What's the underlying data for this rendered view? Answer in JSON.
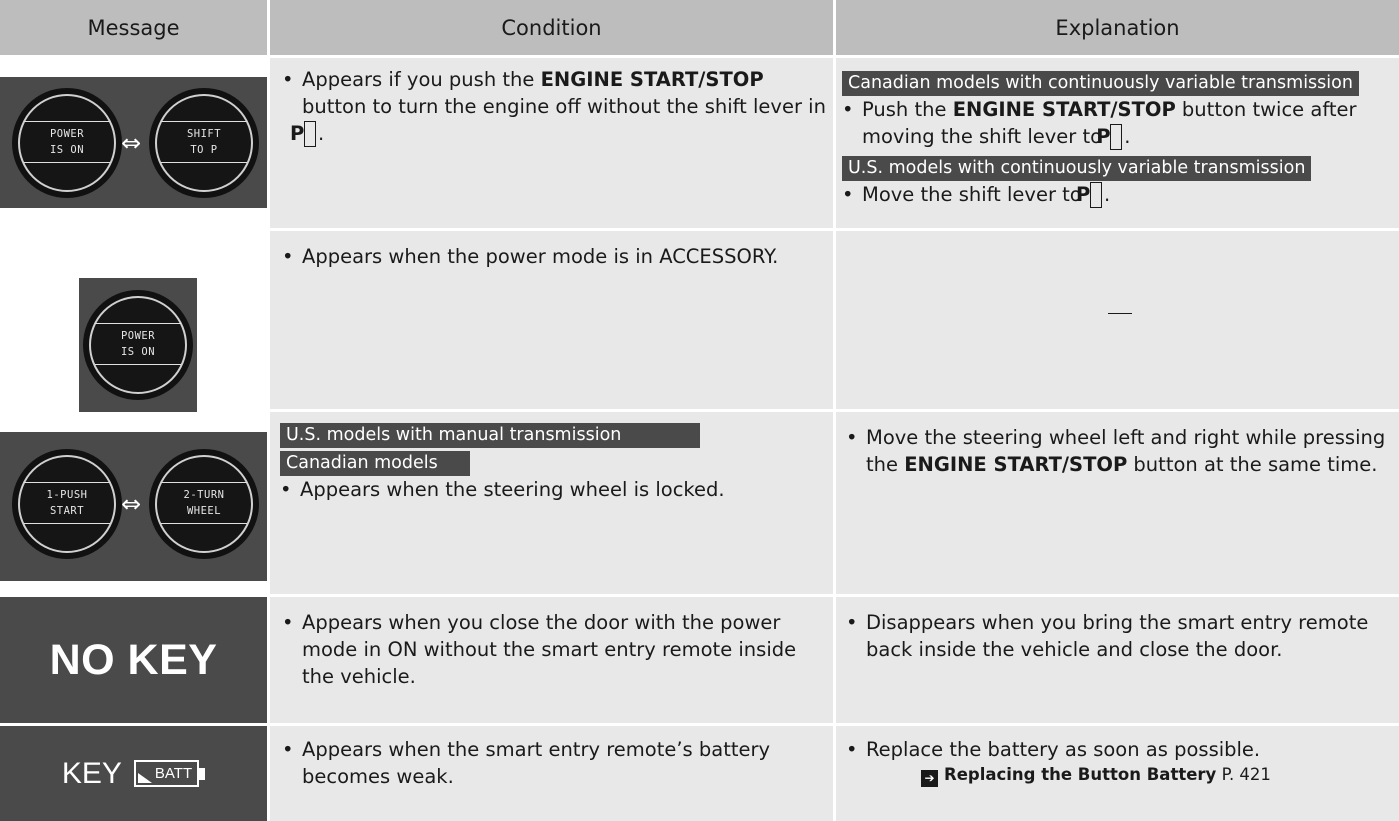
{
  "header": {
    "message": "Message",
    "condition": "Condition",
    "explanation": "Explanation"
  },
  "rows": [
    {
      "message_display": {
        "gauge1": [
          "POWER",
          "IS ON"
        ],
        "gauge2": [
          "SHIFT",
          "TO P"
        ],
        "arrow": "⇔"
      },
      "condition": {
        "pre": "Appears if you push the ",
        "bold": "ENGINE START/STOP",
        "post": " button to turn the engine off without the shift lever in ",
        "gear": "P",
        "end": "."
      },
      "explanation": {
        "tag1": "Canadian models with continuously variable transmission",
        "item1_pre": "Push the ",
        "item1_bold": "ENGINE START/STOP",
        "item1_post": " button twice after moving the shift lever to ",
        "item1_gear": "P",
        "item1_end": ".",
        "tag2": "U.S. models with continuously variable transmission",
        "item2_pre": "Move the shift lever to ",
        "item2_gear": "P",
        "item2_end": "."
      }
    },
    {
      "message_display": {
        "gauge1": [
          "POWER",
          "IS ON"
        ]
      },
      "condition": {
        "text": "Appears when the power mode is in ACCESSORY."
      },
      "explanation": {
        "text": "—"
      }
    },
    {
      "message_display": {
        "gauge1": [
          "1-PUSH",
          "START"
        ],
        "gauge2": [
          "2-TURN",
          "WHEEL"
        ],
        "arrow": "⇔"
      },
      "condition": {
        "tag1": "U.S. models with manual transmission",
        "tag2": "Canadian models",
        "text": "Appears when the steering wheel is locked."
      },
      "explanation": {
        "pre": "Move the steering wheel left and right while pressing the ",
        "bold": "ENGINE START/STOP",
        "post": " button at the same time."
      }
    },
    {
      "message_display": {
        "text": "NO KEY"
      },
      "condition": {
        "text": "Appears when you close the door with the power mode in ON without the smart entry remote inside the vehicle."
      },
      "explanation": {
        "text": "Disappears when you bring the smart entry remote back inside the vehicle and close the door."
      }
    },
    {
      "message_display": {
        "key": "KEY",
        "batt": "BATT"
      },
      "condition": {
        "text": "Appears when the smart entry remote’s battery becomes weak."
      },
      "explanation": {
        "text": "Replace the battery as soon as possible.",
        "ref_title": "Replacing the Button Battery",
        "ref_page": "P. 421"
      }
    }
  ],
  "colors": {
    "header_bg": "#bdbdbd",
    "cell_bg": "#e8e8e8",
    "display_bg": "#4a4a4a",
    "tag_bg": "#4a4a4a"
  },
  "icons": {
    "arrow": "double-arrow-icon",
    "battery": "battery-icon",
    "reference": "arrow-reference-icon"
  }
}
